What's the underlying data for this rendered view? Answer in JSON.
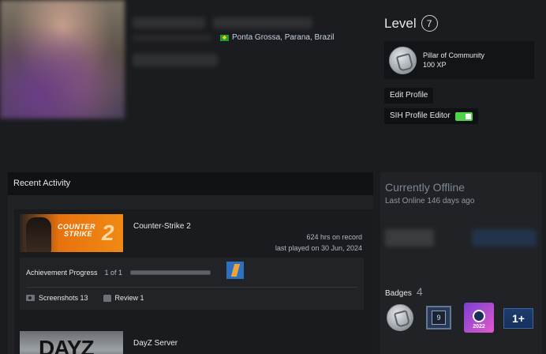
{
  "profile": {
    "location": "Ponta Grossa, Parana, Brazil"
  },
  "level": {
    "label": "Level",
    "value": "7"
  },
  "featured_badge": {
    "name": "Pillar of Community",
    "xp": "100 XP"
  },
  "buttons": {
    "edit_profile": "Edit Profile",
    "sih_profile_editor": "SIH Profile Editor"
  },
  "recent_activity": {
    "title": "Recent Activity",
    "games": [
      {
        "name": "Counter-Strike 2",
        "hours": "624 hrs on record",
        "last_played": "last played on 30 Jun, 2024",
        "capsule_logo_line1": "COUNTER",
        "capsule_logo_line2": "STRIKE",
        "capsule_logo_num": "2",
        "achievement_label": "Achievement Progress",
        "achievement_count": "1 of 1",
        "achievement_progress": 1.0,
        "screenshots": "Screenshots 13",
        "review": "Review 1"
      },
      {
        "name": "DayZ Server",
        "capsule_logo": "DAYZ"
      }
    ]
  },
  "status": {
    "title": "Currently Offline",
    "last_online": "Last Online 146 days ago"
  },
  "badges": {
    "label": "Badges",
    "count": "4",
    "items": [
      {
        "icon": "pillar-of-community-badge-icon"
      },
      {
        "icon": "years-of-service-badge-icon",
        "text": "9"
      },
      {
        "icon": "steam-2022-badge-icon",
        "text": "2022"
      },
      {
        "icon": "one-plus-badge-icon",
        "text": "1+"
      }
    ]
  },
  "colors": {
    "background": "#1b1c1f",
    "panel": "#202226",
    "accent_toggle": "#4ed34a"
  }
}
